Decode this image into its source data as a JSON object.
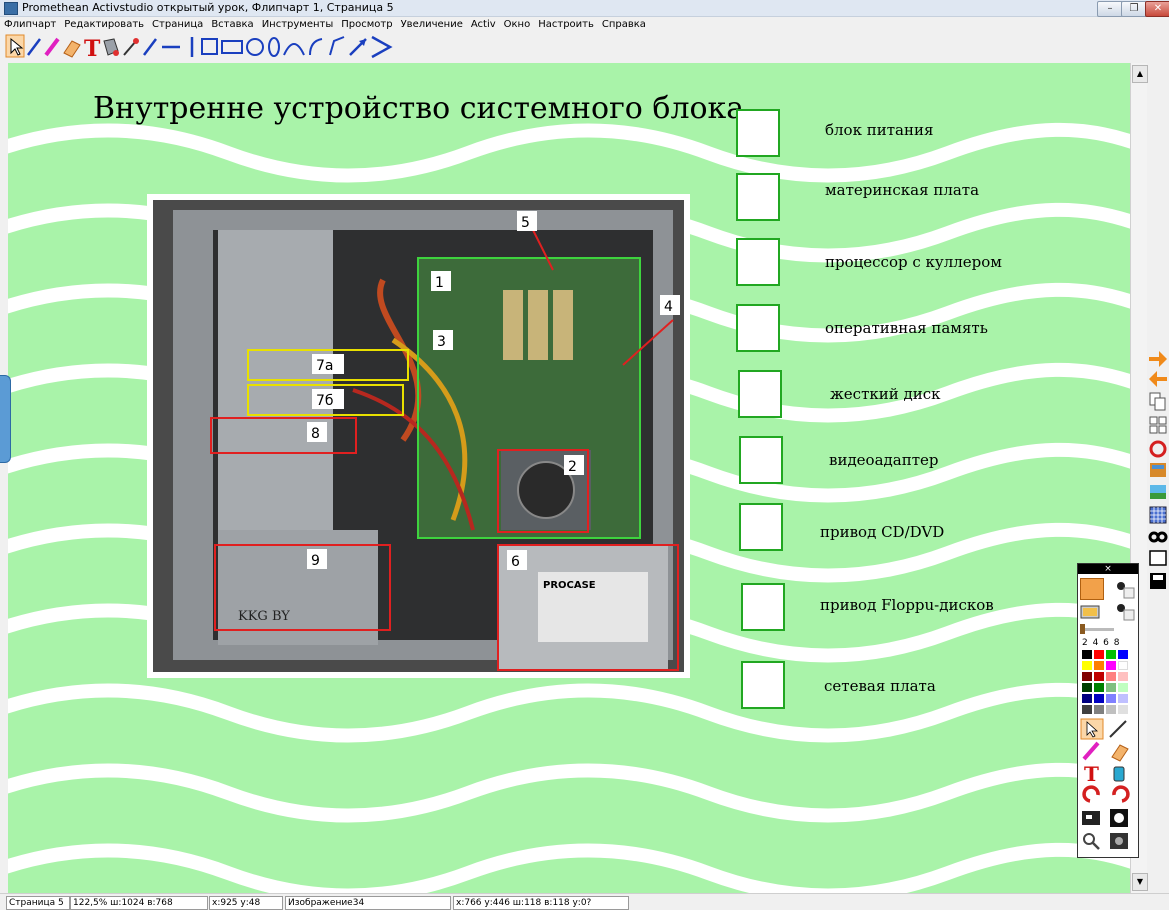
{
  "window": {
    "title": "Promethean Activstudio  открытый урок,  Флипчарт 1,  Страница 5",
    "minimize_label": "–",
    "restore_label": "❐",
    "close_label": "✕"
  },
  "menu": [
    "Флипчарт",
    "Редактировать",
    "Страница",
    "Вставка",
    "Инструменты",
    "Просмотр",
    "Увеличение",
    "Activ",
    "Окно",
    "Настроить",
    "Справка"
  ],
  "toolbar_icons": [
    "select-arrow-icon",
    "pen-icon",
    "highlighter-icon",
    "eraser-icon",
    "text-icon",
    "fill-icon",
    "marker-icon",
    "line-icon",
    "dash-icon",
    "vertical-line-icon",
    "square-icon",
    "rectangle-icon",
    "circle-icon",
    "ellipse-icon",
    "arc-icon",
    "curve-icon",
    "angle-icon",
    "arrow-icon",
    "chevron-icon"
  ],
  "slide": {
    "title": "Внутренне устройство системного блока",
    "photo": {
      "callouts": [
        "1",
        "2",
        "3",
        "4",
        "5",
        "6",
        "7а",
        "7б",
        "8",
        "9"
      ],
      "psu_brand": "PROCASE",
      "floppy_text": "KKG BY"
    },
    "items": [
      {
        "label": "блок питания"
      },
      {
        "label": "материнская плата"
      },
      {
        "label": "процессор с куллером"
      },
      {
        "label": "оперативная память"
      },
      {
        "label": "жесткий диск"
      },
      {
        "label": "видеоадаптер"
      },
      {
        "label": "привод CD/DVD"
      },
      {
        "label": "привод Floppu-дисков"
      },
      {
        "label": "сетевая плата"
      }
    ]
  },
  "palette": {
    "close_label": "×",
    "widths": "2  4  6  8",
    "colors": [
      "#000000",
      "#ff0000",
      "#00c000",
      "#0000ff",
      "#ffff00",
      "#ff8000",
      "#ff00ff",
      "#ffffff",
      "#800000",
      "#c00000",
      "#ff8080",
      "#ffc0c0",
      "#004000",
      "#008000",
      "#80c080",
      "#c0ffc0",
      "#000080",
      "#0000c0",
      "#8080ff",
      "#c0c0ff",
      "#404040",
      "#808080",
      "#c0c0c0",
      "#e0e0e0"
    ]
  },
  "status": {
    "page": "Страница 5",
    "zoom": "122,5%  ш:1024  в:768",
    "cursor": "x:925  у:48",
    "object": "Изображение34",
    "geometry": "x:766  у:446  ш:118  в:118  у:0?"
  },
  "colors": {
    "canvas_bg": "#a9f3a9",
    "wave": "#ffffff",
    "checkbox_border": "#21a721"
  }
}
